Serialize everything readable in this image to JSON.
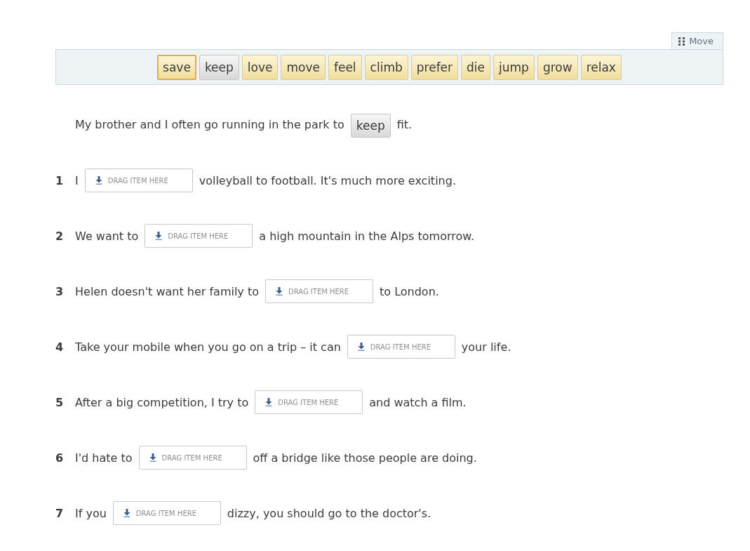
{
  "word_bank": {
    "move_handle": "Move",
    "words": [
      {
        "text": "save",
        "selected": true,
        "used": false
      },
      {
        "text": "keep",
        "selected": false,
        "used": true
      },
      {
        "text": "love",
        "selected": false,
        "used": false
      },
      {
        "text": "move",
        "selected": false,
        "used": false
      },
      {
        "text": "feel",
        "selected": false,
        "used": false
      },
      {
        "text": "climb",
        "selected": false,
        "used": false
      },
      {
        "text": "prefer",
        "selected": false,
        "used": false
      },
      {
        "text": "die",
        "selected": false,
        "used": false
      },
      {
        "text": "jump",
        "selected": false,
        "used": false
      },
      {
        "text": "grow",
        "selected": false,
        "used": false
      },
      {
        "text": "relax",
        "selected": false,
        "used": false
      }
    ]
  },
  "example": {
    "before": "My brother and I often go running in the park to",
    "answer": "keep",
    "after": "fit."
  },
  "questions": [
    {
      "number": "1",
      "before": "I",
      "placeholder": "DRAG ITEM HERE",
      "after": "volleyball to football. It's much more exciting."
    },
    {
      "number": "2",
      "before": "We want to",
      "placeholder": "DRAG ITEM HERE",
      "after": "a high mountain in the Alps tomorrow."
    },
    {
      "number": "3",
      "before": "Helen doesn't want her family to",
      "placeholder": "DRAG ITEM HERE",
      "after": "to London."
    },
    {
      "number": "4",
      "before": "Take your mobile when you go on a trip – it can",
      "placeholder": "DRAG ITEM HERE",
      "after": "your life."
    },
    {
      "number": "5",
      "before": "After a big competition, I try to",
      "placeholder": "DRAG ITEM HERE",
      "after": "and watch a film."
    },
    {
      "number": "6",
      "before": "I'd hate to",
      "placeholder": "DRAG ITEM HERE",
      "after": "off a bridge like those people are doing."
    },
    {
      "number": "7",
      "before": "If you",
      "placeholder": "DRAG ITEM HERE",
      "after": "dizzy, you should go to the doctor's."
    }
  ]
}
